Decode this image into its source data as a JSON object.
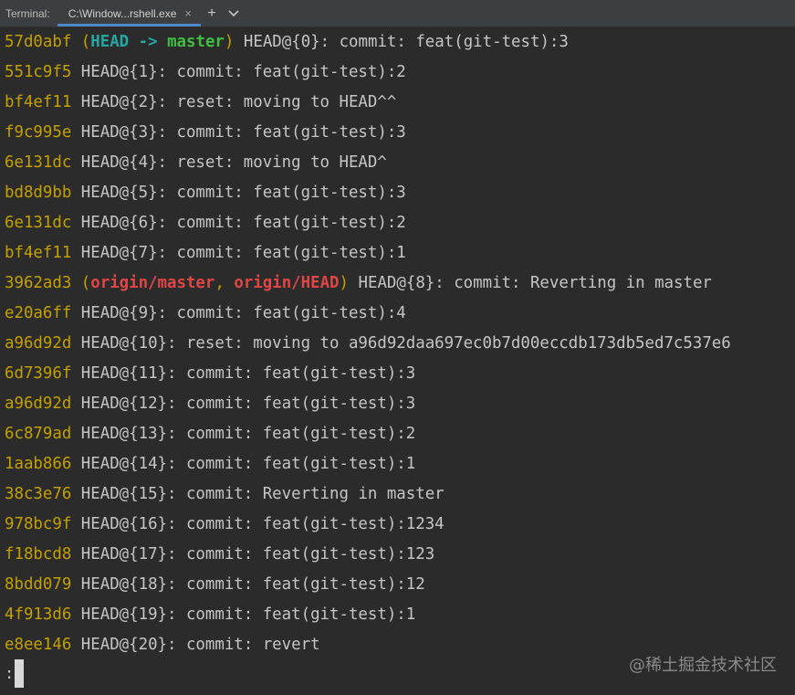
{
  "window": {
    "tool_window_title": "Terminal:",
    "tab_label": "C:\\Window...rshell.exe",
    "tab_close_glyph": "×",
    "add_tab_glyph": "+",
    "tab_menu_glyph": "⌄"
  },
  "colors": {
    "background": "#2b2b2b",
    "hash": "#c4a000",
    "head_ref": "#23a9a2",
    "local_branch": "#3fbf3f",
    "remote_branch": "#e04646",
    "text": "#c5c5c5",
    "tab_underline": "#4a88c7"
  },
  "reflog": [
    {
      "hash": "57d0abf",
      "decoration": {
        "head": "HEAD",
        "arrow": "->",
        "branch": "master",
        "type": "local"
      },
      "selector": "HEAD@{0}",
      "message": ": commit: feat(git-test):3"
    },
    {
      "hash": "551c9f5",
      "selector": "HEAD@{1}",
      "message": ": commit: feat(git-test):2"
    },
    {
      "hash": "bf4ef11",
      "selector": "HEAD@{2}",
      "message": ": reset: moving to HEAD^^"
    },
    {
      "hash": "f9c995e",
      "selector": "HEAD@{3}",
      "message": ": commit: feat(git-test):3"
    },
    {
      "hash": "6e131dc",
      "selector": "HEAD@{4}",
      "message": ": reset: moving to HEAD^"
    },
    {
      "hash": "bd8d9bb",
      "selector": "HEAD@{5}",
      "message": ": commit: feat(git-test):3"
    },
    {
      "hash": "6e131dc",
      "selector": "HEAD@{6}",
      "message": ": commit: feat(git-test):2"
    },
    {
      "hash": "bf4ef11",
      "selector": "HEAD@{7}",
      "message": ": commit: feat(git-test):1"
    },
    {
      "hash": "3962ad3",
      "decoration": {
        "remote1": "origin/master",
        "comma": ",",
        "remote2": "origin/HEAD",
        "type": "remote"
      },
      "selector": "HEAD@{8}",
      "message": ": commit: Reverting in master"
    },
    {
      "hash": "e20a6ff",
      "selector": "HEAD@{9}",
      "message": ": commit: feat(git-test):4"
    },
    {
      "hash": "a96d92d",
      "selector": "HEAD@{10}",
      "message": ": reset: moving to a96d92daa697ec0b7d00eccdb173db5ed7c537e6"
    },
    {
      "hash": "6d7396f",
      "selector": "HEAD@{11}",
      "message": ": commit: feat(git-test):3"
    },
    {
      "hash": "a96d92d",
      "selector": "HEAD@{12}",
      "message": ": commit: feat(git-test):3"
    },
    {
      "hash": "6c879ad",
      "selector": "HEAD@{13}",
      "message": ": commit: feat(git-test):2"
    },
    {
      "hash": "1aab866",
      "selector": "HEAD@{14}",
      "message": ": commit: feat(git-test):1"
    },
    {
      "hash": "38c3e76",
      "selector": "HEAD@{15}",
      "message": ": commit: Reverting in master"
    },
    {
      "hash": "978bc9f",
      "selector": "HEAD@{16}",
      "message": ": commit: feat(git-test):1234"
    },
    {
      "hash": "f18bcd8",
      "selector": "HEAD@{17}",
      "message": ": commit: feat(git-test):123"
    },
    {
      "hash": "8bdd079",
      "selector": "HEAD@{18}",
      "message": ": commit: feat(git-test):12"
    },
    {
      "hash": "4f913d6",
      "selector": "HEAD@{19}",
      "message": ": commit: feat(git-test):1"
    },
    {
      "hash": "e8ee146",
      "selector": "HEAD@{20}",
      "message": ": commit: revert"
    }
  ],
  "prompt": {
    "text": ":"
  },
  "watermark": "@稀土掘金技术社区"
}
